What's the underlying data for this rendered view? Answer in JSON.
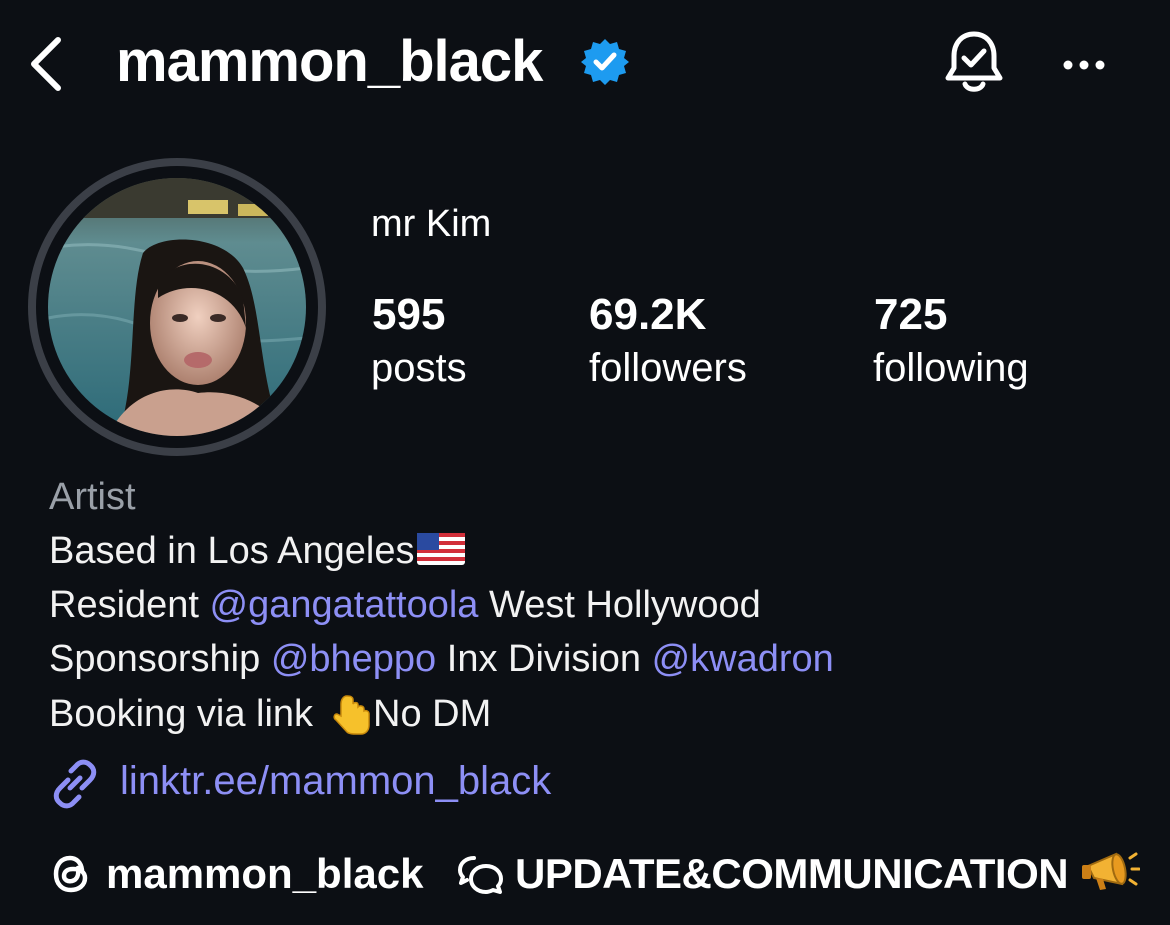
{
  "header": {
    "back_icon": "chevron-left-icon",
    "username": "mammon_black",
    "verified_icon": "verified-badge-icon",
    "bell_icon": "bell-check-icon",
    "more_icon": "more-horizontal-icon"
  },
  "profile": {
    "display_name": "mr Kim",
    "stats": [
      {
        "value": "595",
        "label": "posts"
      },
      {
        "value": "69.2K",
        "label": "followers"
      },
      {
        "value": "725",
        "label": "following"
      }
    ]
  },
  "bio": {
    "category": "Artist",
    "line1": "Based in Los Angeles",
    "line2_prefix": "Resident ",
    "line2_mention": "@gangatattoola",
    "line2_suffix": " West Hollywood",
    "line3_prefix": "Sponsorship ",
    "line3_mention1": "@bheppo",
    "line3_middle": " Inx Division ",
    "line3_mention2": "@kwadron",
    "line4_prefix": "Booking via link",
    "line4_suffix": "No DM",
    "link": "linktr.ee/mammon_black"
  },
  "footer": {
    "threads_handle": "mammon_black",
    "channel_name": "UPDATE&COMMUNICATION"
  },
  "colors": {
    "background": "#0c0f14",
    "accent_link": "#8d8ff5",
    "verified": "#1d9bf0"
  }
}
